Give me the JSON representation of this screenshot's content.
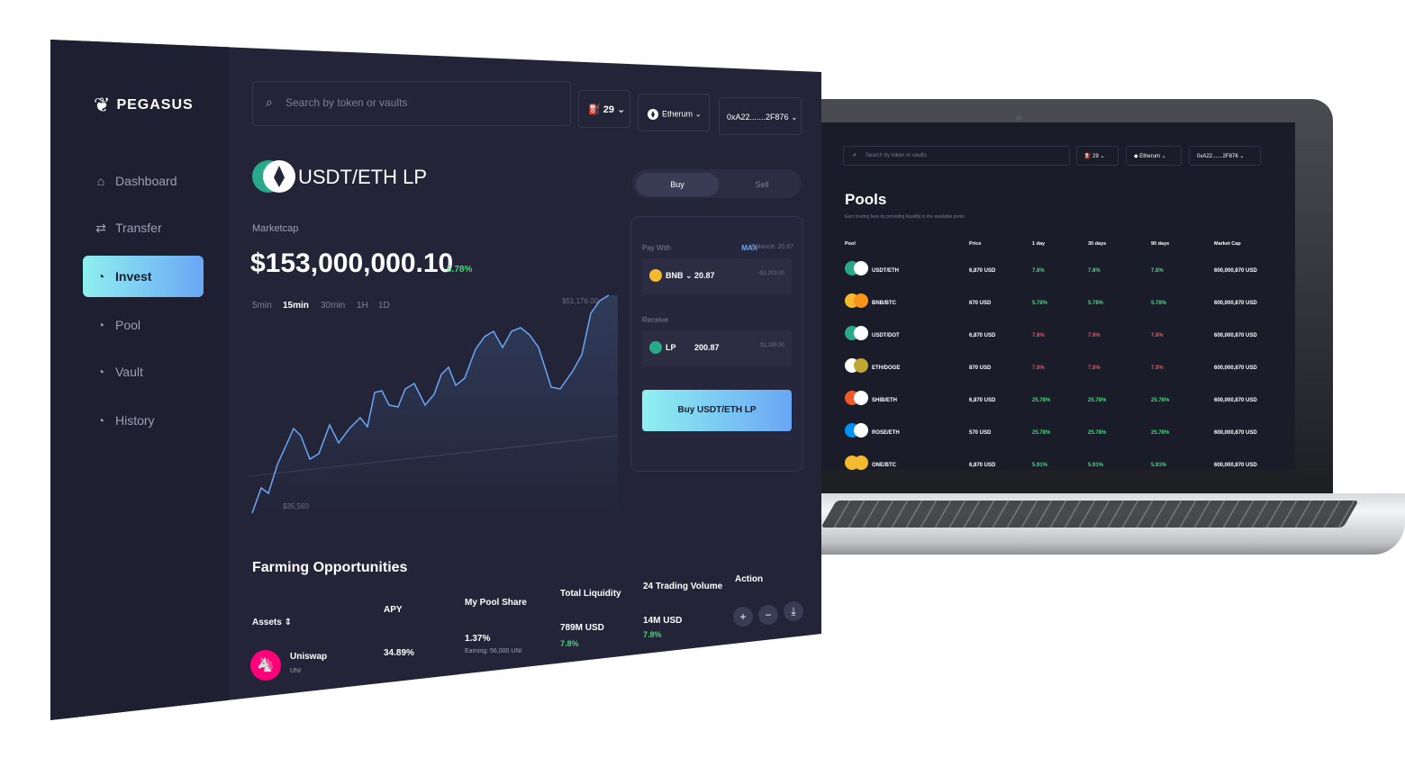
{
  "dashboard": {
    "brand": "PEGASUS",
    "nav": [
      {
        "label": "Dashboard",
        "icon": "home-icon"
      },
      {
        "label": "Transfer",
        "icon": "transfer-icon"
      },
      {
        "label": "Invest",
        "icon": "pie-icon",
        "active": true
      },
      {
        "label": "Pool",
        "icon": "pie-icon"
      },
      {
        "label": "Vault",
        "icon": "pie-icon"
      },
      {
        "label": "History",
        "icon": "pie-icon"
      }
    ],
    "search_placeholder": "Search by token or vaults",
    "gas": "29",
    "network": "Etherum",
    "wallet": "0xA22.......2F876",
    "pair": "USDT/ETH LP",
    "marketcap_label": "Marketcap",
    "marketcap_value": "$153,000,000.10",
    "marketcap_change": "5.78%",
    "timeframes": [
      "5min",
      "15min",
      "30min",
      "1H",
      "1D"
    ],
    "active_timeframe": "15min",
    "chart_max": "$51,176.00",
    "chart_min": "$35,560",
    "trade": {
      "buy_tab": "Buy",
      "sell_tab": "Sell",
      "pay_with_label": "Pay With",
      "max_label": "MAX",
      "balance": "Balance: 20.87",
      "pay_token": "BNB",
      "pay_amount": "20.87",
      "pay_usd": "~$1,203.00",
      "receive_label": "Receive",
      "receive_token": "LP",
      "receive_amount": "200.87",
      "receive_usd": "$1,199.00",
      "button": "Buy USDT/ETH LP"
    },
    "farming": {
      "title": "Farming Opportunities",
      "headers": [
        "Assets",
        "APY",
        "My Pool Share",
        "Total Liquidity",
        "24 Trading Volume",
        "Action"
      ],
      "row": {
        "name": "Uniswap",
        "symbol": "UNI",
        "apy": "34.89%",
        "share": "1.37%",
        "earning": "Earning: 56,000 UNI",
        "liquidity": "789M USD",
        "liquidity_change": "7.8%",
        "volume": "14M USD",
        "volume_change": "7.8%"
      }
    }
  },
  "laptop": {
    "search_placeholder": "Search by token or vaults",
    "gas": "29",
    "network": "Etherum",
    "wallet": "0xA22.......2F876",
    "title": "Pools",
    "subtitle": "Earn trading fees by providing liquidity in the available pools",
    "headers": [
      "Pool",
      "Price",
      "1 day",
      "30 days",
      "90 days",
      "Market Cap"
    ],
    "rows": [
      {
        "pool": "USDT/ETH",
        "price": "6,870 USD",
        "d1": "7.8%",
        "d30": "7.8%",
        "d90": "7.8%",
        "mc": "600,000,870 USD",
        "trend": "pos",
        "c1": "#2aa88a",
        "c2": "#ffffff"
      },
      {
        "pool": "BNB/BTC",
        "price": "670 USD",
        "d1": "5.78%",
        "d30": "5.78%",
        "d90": "5.78%",
        "mc": "600,000,870 USD",
        "trend": "pos",
        "c1": "#f3ba2f",
        "c2": "#f7931a"
      },
      {
        "pool": "USDT/DOT",
        "price": "6,870 USD",
        "d1": "7.8%",
        "d30": "7.8%",
        "d90": "7.8%",
        "mc": "600,000,870 USD",
        "trend": "neg",
        "c1": "#2aa88a",
        "c2": "#ffffff"
      },
      {
        "pool": "ETH/DOGE",
        "price": "870 USD",
        "d1": "7.8%",
        "d30": "7.8%",
        "d90": "7.8%",
        "mc": "600,000,870 USD",
        "trend": "neg",
        "c1": "#ffffff",
        "c2": "#c2a633"
      },
      {
        "pool": "SHIB/ETH",
        "price": "6,870 USD",
        "d1": "25.78%",
        "d30": "25.78%",
        "d90": "25.78%",
        "mc": "600,000,870 USD",
        "trend": "pos",
        "c1": "#f0572b",
        "c2": "#ffffff"
      },
      {
        "pool": "ROSE/ETH",
        "price": "570 USD",
        "d1": "25.78%",
        "d30": "25.78%",
        "d90": "25.78%",
        "mc": "600,000,870 USD",
        "trend": "pos",
        "c1": "#0092f6",
        "c2": "#ffffff"
      },
      {
        "pool": "ONE/BTC",
        "price": "6,870 USD",
        "d1": "5.91%",
        "d30": "5.91%",
        "d90": "5.91%",
        "mc": "600,000,870 USD",
        "trend": "pos",
        "c1": "#f3ba2f",
        "c2": "#f3ba2f"
      }
    ]
  }
}
